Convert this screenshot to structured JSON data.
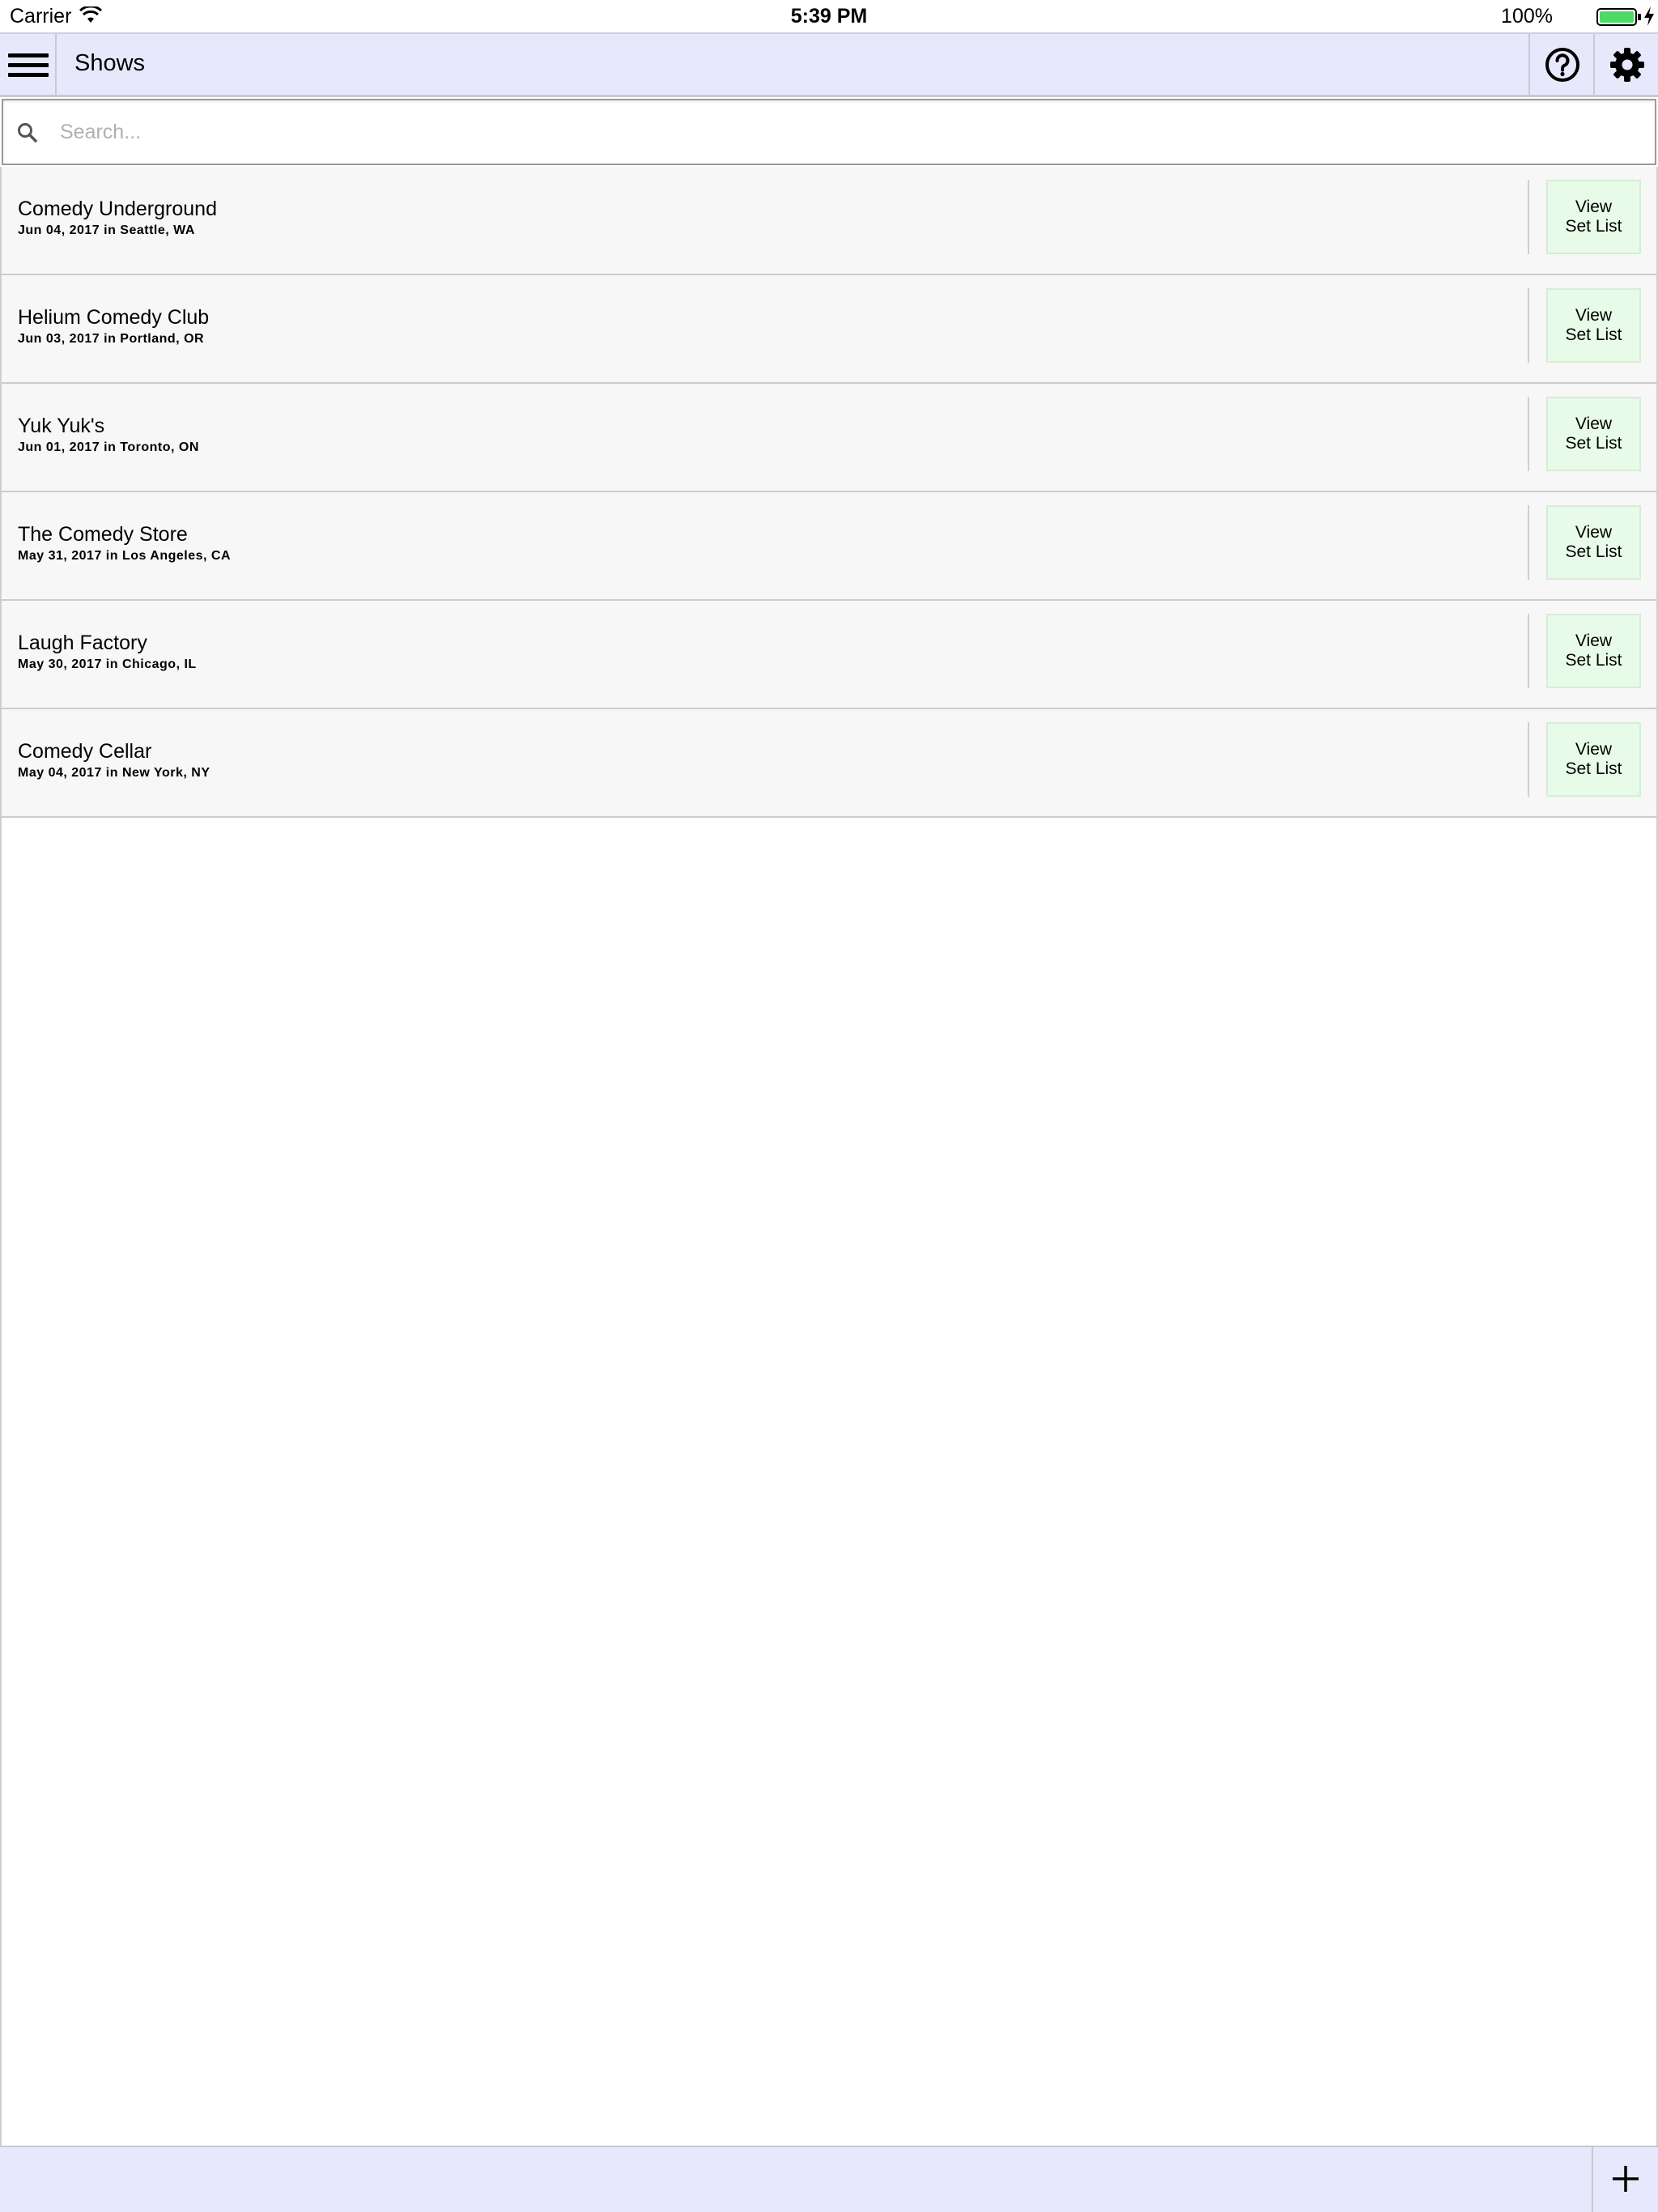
{
  "status_bar": {
    "carrier": "Carrier",
    "time": "5:39 PM",
    "battery": "100%",
    "battery_color": "#4cd964"
  },
  "header": {
    "title": "Shows",
    "menu_icon": "hamburger-icon",
    "help_icon": "question-circle-icon",
    "settings_icon": "gear-icon",
    "background": "#e8e8fc"
  },
  "search": {
    "placeholder": "Search...",
    "value": ""
  },
  "shows": [
    {
      "name": "Comedy Underground",
      "details": "Jun 04, 2017 in Seattle, WA",
      "button_line1": "View",
      "button_line2": "Set List"
    },
    {
      "name": "Helium Comedy Club",
      "details": "Jun 03, 2017 in Portland, OR",
      "button_line1": "View",
      "button_line2": "Set List"
    },
    {
      "name": "Yuk Yuk's",
      "details": "Jun 01, 2017 in Toronto, ON",
      "button_line1": "View",
      "button_line2": "Set List"
    },
    {
      "name": "The Comedy Store",
      "details": "May 31, 2017 in Los Angeles, CA",
      "button_line1": "View",
      "button_line2": "Set List"
    },
    {
      "name": "Laugh Factory",
      "details": "May 30, 2017 in Chicago, IL",
      "button_line1": "View",
      "button_line2": "Set List"
    },
    {
      "name": "Comedy Cellar",
      "details": "May 04, 2017 in New York, NY",
      "button_line1": "View",
      "button_line2": "Set List"
    }
  ],
  "footer": {
    "add_icon": "plus-icon",
    "background": "#e8e8fc"
  },
  "colors": {
    "view_button_bg": "#e8fbe8",
    "row_bg": "#f7f7f7"
  }
}
